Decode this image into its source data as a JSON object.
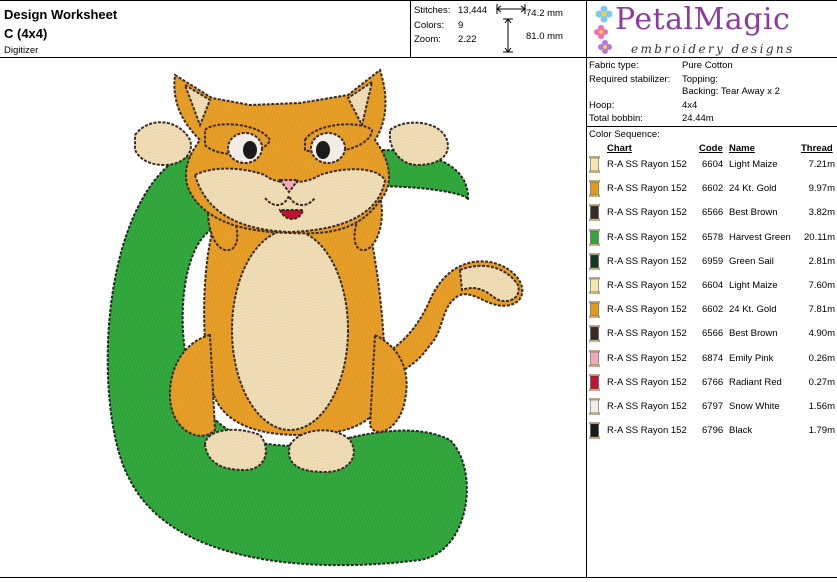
{
  "header": {
    "title": "Design Worksheet",
    "design_name": "C (4x4)",
    "digitizer_label": "Digitizer"
  },
  "stats": {
    "stitches_label": "Stitches:",
    "stitches": "13,444",
    "colors_label": "Colors:",
    "colors": "9",
    "zoom_label": "Zoom:",
    "zoom": "2.22",
    "width": "74.2 mm",
    "height": "81.0 mm"
  },
  "logo": {
    "name": "PetalMagic",
    "tagline": "embroidery designs",
    "color": "#8e3aa3"
  },
  "fabric": {
    "fabric_type_label": "Fabric type:",
    "fabric_type": "Pure Cotton",
    "stabilizer_label": "Required stabilizer:",
    "topping": "Topping:",
    "backing": "Backing: Tear Away x 2",
    "hoop_label": "Hoop:",
    "hoop": "4x4",
    "bobbin_label": "Total bobbin:",
    "bobbin": "24.44m"
  },
  "color_sequence": {
    "title": "Color Sequence:",
    "headers": {
      "chart": "Chart",
      "code": "Code",
      "name": "Name",
      "thread": "Thread"
    },
    "rows": [
      {
        "chart": "R-A SS Rayon 152",
        "code": "6604",
        "name": "Light Maize",
        "thread": "7.21m",
        "color": "#f6e6a8"
      },
      {
        "chart": "R-A SS Rayon 152",
        "code": "6602",
        "name": "24 Kt. Gold",
        "thread": "9.97m",
        "color": "#e59a13"
      },
      {
        "chart": "R-A SS Rayon 152",
        "code": "6566",
        "name": "Best Brown",
        "thread": "3.82m",
        "color": "#3a2a22"
      },
      {
        "chart": "R-A SS Rayon 152",
        "code": "6578",
        "name": "Harvest Green",
        "thread": "20.11m",
        "color": "#2ea83a"
      },
      {
        "chart": "R-A SS Rayon 152",
        "code": "6959",
        "name": "Green Sail",
        "thread": "2.81m",
        "color": "#143a22"
      },
      {
        "chart": "R-A SS Rayon 152",
        "code": "6604",
        "name": "Light Maize",
        "thread": "7.60m",
        "color": "#f6e6a8"
      },
      {
        "chart": "R-A SS Rayon 152",
        "code": "6602",
        "name": "24 Kt. Gold",
        "thread": "7.81m",
        "color": "#e59a13"
      },
      {
        "chart": "R-A SS Rayon 152",
        "code": "6566",
        "name": "Best Brown",
        "thread": "4.90m",
        "color": "#3a2a22"
      },
      {
        "chart": "R-A SS Rayon 152",
        "code": "6874",
        "name": "Emily Pink",
        "thread": "0.26m",
        "color": "#f4aab4"
      },
      {
        "chart": "R-A SS Rayon 152",
        "code": "6766",
        "name": "Radiant Red",
        "thread": "0.27m",
        "color": "#c3122f"
      },
      {
        "chart": "R-A SS Rayon 152",
        "code": "6797",
        "name": "Snow White",
        "thread": "1.56m",
        "color": "#f3ebe6"
      },
      {
        "chart": "R-A SS Rayon 152",
        "code": "6796",
        "name": "Black",
        "thread": "1.79m",
        "color": "#1a1a1a"
      }
    ]
  },
  "design_colors": {
    "green": "#2fa33a",
    "gold": "#e39a22",
    "maize": "#ecd9b0",
    "brown": "#3a2a22"
  }
}
